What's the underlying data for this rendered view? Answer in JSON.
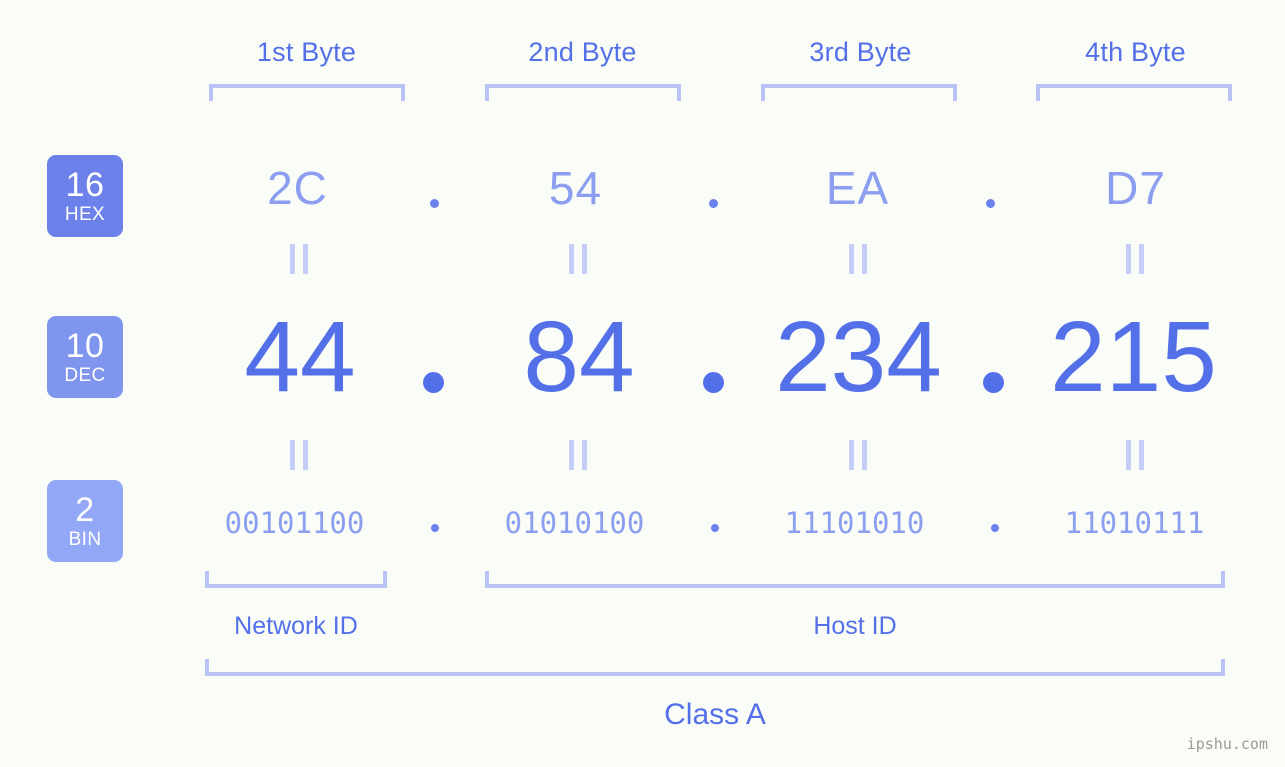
{
  "meta": {
    "background_color": "#fafcf7",
    "accent_primary": "#5470e8",
    "accent_light": "#8b9ef0",
    "accent_pale": "#b9c3f5",
    "watermark": "ipshu.com"
  },
  "byte_headers": [
    {
      "label": "1st Byte"
    },
    {
      "label": "2nd Byte"
    },
    {
      "label": "3rd Byte"
    },
    {
      "label": "4th Byte"
    }
  ],
  "bases": [
    {
      "id": "hex",
      "number": "16",
      "name": "HEX",
      "color": "#6d81ea"
    },
    {
      "id": "dec",
      "number": "10",
      "name": "DEC",
      "color": "#8095ee"
    },
    {
      "id": "bin",
      "number": "2",
      "name": "BIN",
      "color": "#92a7f5"
    }
  ],
  "rows": {
    "hex": {
      "values": [
        "2C",
        "54",
        "EA",
        "D7"
      ],
      "separator": "."
    },
    "dec": {
      "values": [
        "44",
        "84",
        "234",
        "215"
      ],
      "separator": "."
    },
    "bin": {
      "values": [
        "00101100",
        "01010100",
        "11101010",
        "11010111"
      ],
      "separator": "."
    }
  },
  "equality_marks": {
    "hex_to_dec": "=",
    "dec_to_bin": "="
  },
  "segments": {
    "network_id": {
      "label": "Network ID"
    },
    "host_id": {
      "label": "Host ID"
    },
    "class": {
      "label": "Class A"
    }
  },
  "ip_address": {
    "hex": "2C.54.EA.D7",
    "decimal": "44.84.234.215",
    "binary": "00101100.01010100.11101010.11010111",
    "class": "Class A"
  }
}
